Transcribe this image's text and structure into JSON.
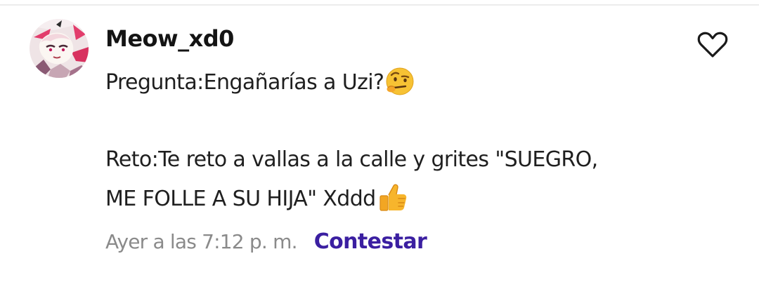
{
  "comment": {
    "username": "Meow_xd0",
    "avatar_icon": "anime-character-avatar",
    "like_icon": "heart-outline-icon",
    "lines": [
      {
        "text": "Pregunta:Engañarías a Uzi?",
        "emoji": "face-with-raised-eyebrow-icon"
      },
      {
        "text": "Reto:Te reto a vallas a la calle y grites \"SUEGRO,"
      },
      {
        "text": "ME FOLLE A SU HIJA\" Xddd",
        "emoji": "thumbs-up-icon"
      }
    ],
    "timestamp": "Ayer a las 7:12 p. m.",
    "reply_label": "Contestar"
  },
  "colors": {
    "text": "#1f1f1f",
    "username": "#141414",
    "timestamp": "#8a8a8a",
    "reply": "#3b1fa1",
    "divider": "#ececec"
  }
}
